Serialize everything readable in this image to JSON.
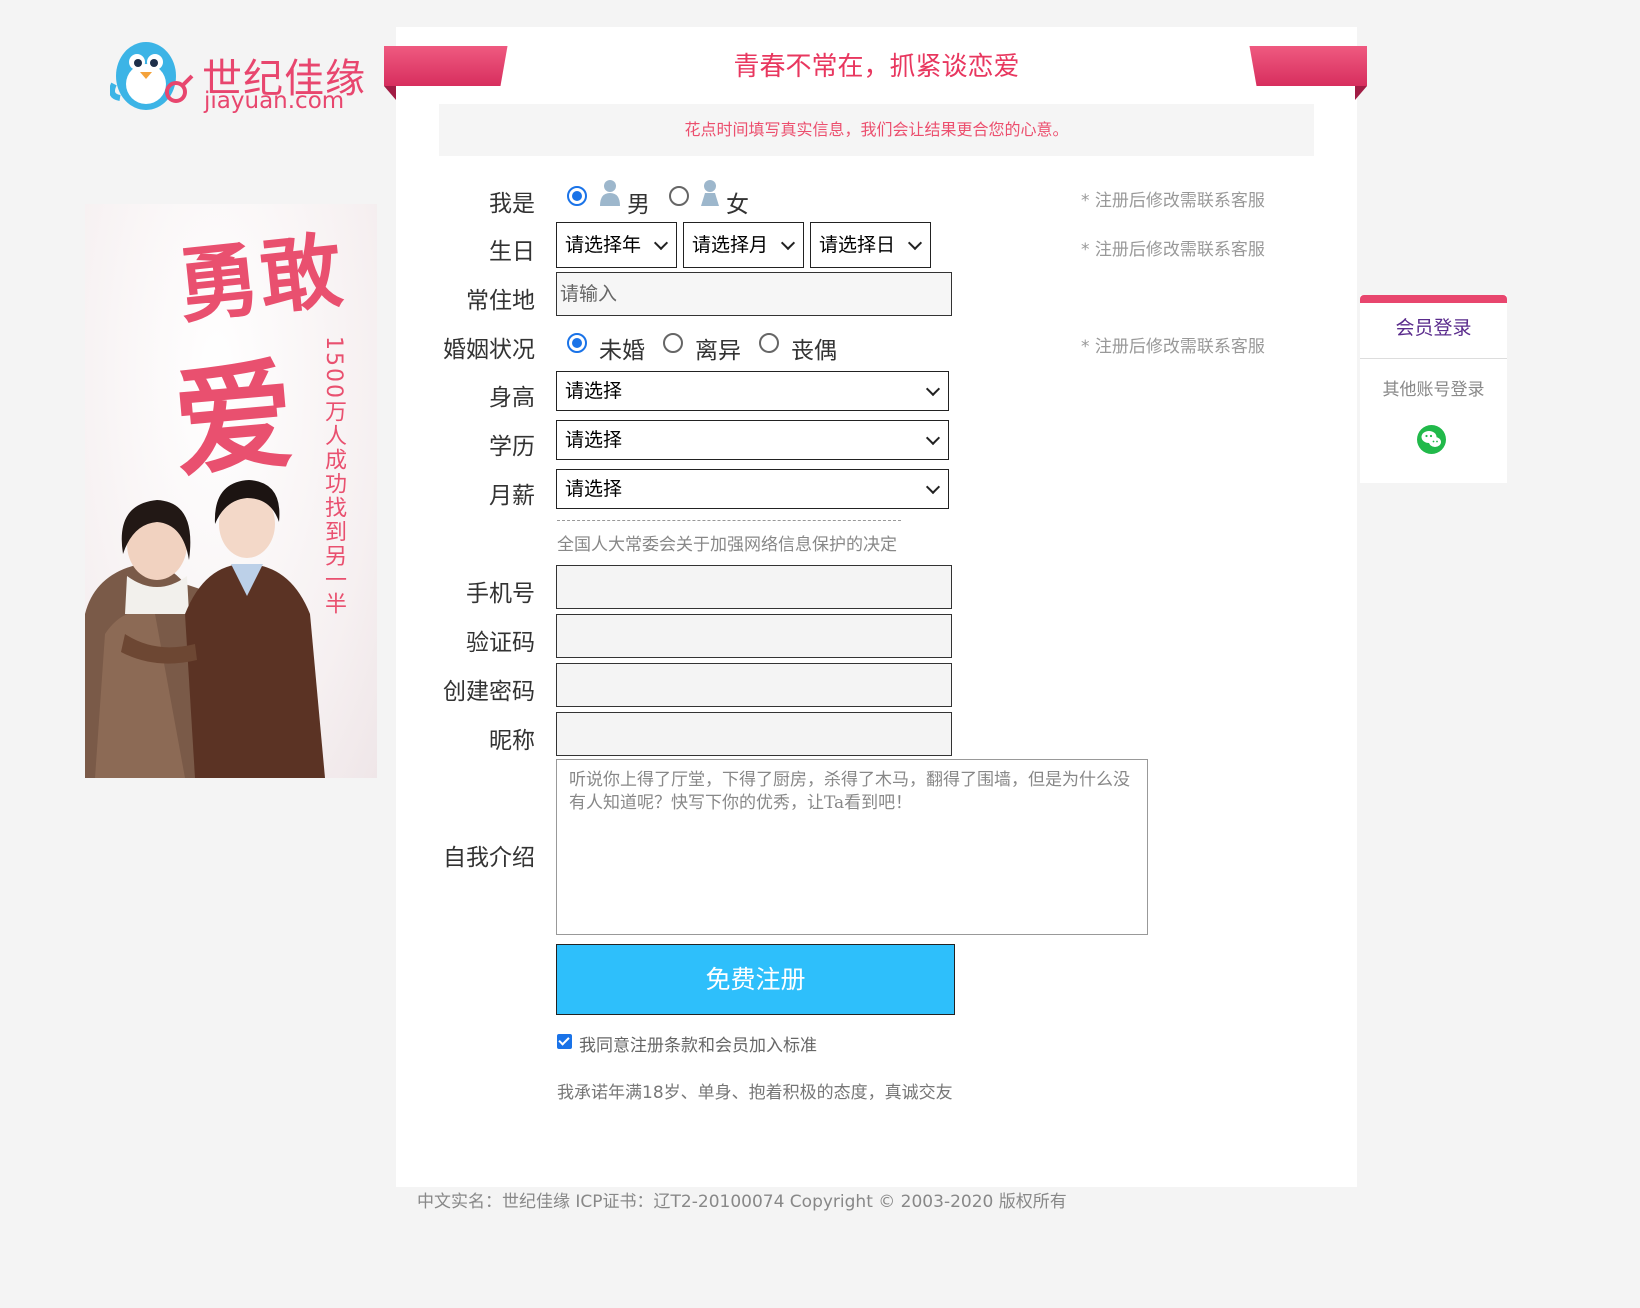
{
  "brand": {
    "name_cn": "世纪佳缘",
    "domain": "jiayuan.com"
  },
  "banner": {
    "headline_1": "勇敢",
    "headline_2": "爱",
    "tagline": "1500万人成功找到另一半"
  },
  "header": {
    "slogan": "青春不常在，抓紧谈恋爱",
    "notice": "花点时间填写真实信息，我们会让结果更合您的心意。"
  },
  "form": {
    "gender": {
      "label": "我是",
      "options": [
        "男",
        "女"
      ],
      "selected": "男",
      "hint": "* 注册后修改需联系客服"
    },
    "birthday": {
      "label": "生日",
      "year": "请选择年",
      "month": "请选择月",
      "day": "请选择日",
      "hint": "* 注册后修改需联系客服"
    },
    "residence": {
      "label": "常住地",
      "placeholder": "请输入"
    },
    "marital": {
      "label": "婚姻状况",
      "options": [
        "未婚",
        "离异",
        "丧偶"
      ],
      "selected": "未婚",
      "hint": "* 注册后修改需联系客服"
    },
    "height": {
      "label": "身高",
      "value": "请选择"
    },
    "education": {
      "label": "学历",
      "value": "请选择"
    },
    "salary": {
      "label": "月薪",
      "value": "请选择"
    },
    "privacy_link": "全国人大常委会关于加强网络信息保护的决定",
    "phone": {
      "label": "手机号",
      "value": ""
    },
    "captcha": {
      "label": "验证码",
      "value": ""
    },
    "password": {
      "label": "创建密码",
      "value": ""
    },
    "nickname": {
      "label": "昵称",
      "value": ""
    },
    "intro": {
      "label": "自我介绍",
      "placeholder": "听说你上得了厅堂，下得了厨房，杀得了木马，翻得了围墙，但是为什么没有人知道呢？快写下你的优秀，让Ta看到吧！"
    },
    "submit": "免费注册",
    "agree": {
      "checked": true,
      "label": "我同意注册条款和会员加入标准"
    },
    "promise": "我承诺年满18岁、单身、抱着积极的态度，真诚交友"
  },
  "login": {
    "title": "会员登录",
    "other": "其他账号登录",
    "wechat_icon": "wechat-icon"
  },
  "footer": {
    "text": "中文实名：世纪佳缘 ICP证书：辽T2-20100074 Copyright © 2003-2020 版权所有"
  },
  "colors": {
    "brand_pink": "#e8466e",
    "submit_blue": "#2ebffb",
    "radio_blue": "#1a73e8",
    "login_purple": "#5a2b8c"
  }
}
